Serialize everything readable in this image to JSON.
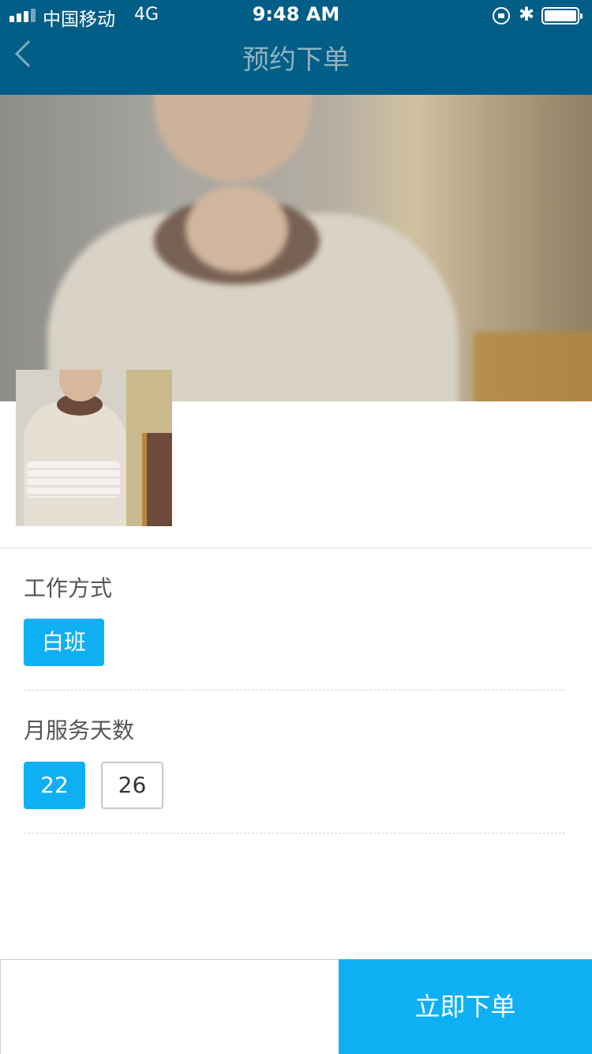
{
  "status_bar": {
    "carrier": "中国移动",
    "network": "4G",
    "time": "9:48 AM",
    "icons": [
      "signal-icon",
      "orientation-lock-icon",
      "bluetooth-icon",
      "battery-icon"
    ],
    "bluetooth_glyph": "✱"
  },
  "nav": {
    "title": "预约下单",
    "back_icon": "chevron-left-icon"
  },
  "work_mode": {
    "label": "工作方式",
    "options": [
      {
        "label": "白班",
        "selected": true
      }
    ]
  },
  "service_days": {
    "label": "月服务天数",
    "options": [
      {
        "label": "22",
        "selected": true
      },
      {
        "label": "26",
        "selected": false
      }
    ]
  },
  "footer": {
    "order_button": "立即下单"
  },
  "colors": {
    "header_bg": "#035e87",
    "accent": "#0fb0f3",
    "nav_title": "#8fb2c2"
  }
}
